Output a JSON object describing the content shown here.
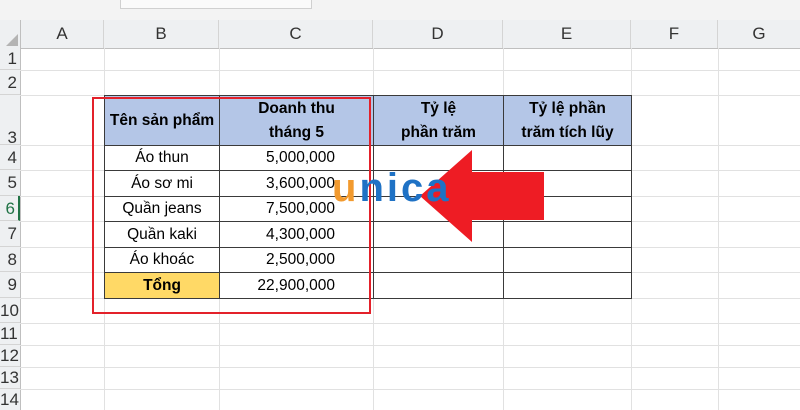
{
  "columns": [
    "A",
    "B",
    "C",
    "D",
    "E",
    "F",
    "G"
  ],
  "rows": [
    "1",
    "2",
    "3",
    "4",
    "5",
    "6",
    "7",
    "8",
    "9",
    "10",
    "11",
    "12",
    "13",
    "14"
  ],
  "table": {
    "header": {
      "product": "Tên sản phẩm",
      "revenue": "Doanh thu\ntháng 5",
      "percent": "Tỷ lệ\nphần trăm",
      "cumulative": "Tỷ lệ phần\ntrăm tích lũy"
    },
    "items": [
      {
        "name": "Áo thun",
        "revenue": "5,000,000"
      },
      {
        "name": "Áo sơ mi",
        "revenue": "3,600,000"
      },
      {
        "name": "Quần jeans",
        "revenue": "7,500,000"
      },
      {
        "name": "Quần kaki",
        "revenue": "4,300,000"
      },
      {
        "name": "Áo khoác",
        "revenue": "2,500,000"
      }
    ],
    "total": {
      "label": "Tổng",
      "revenue": "22,900,000"
    }
  },
  "watermark": {
    "first": "u",
    "rest": "nica"
  },
  "colors": {
    "header_fill": "#b4c6e7",
    "total_fill": "#ffd966",
    "highlight": "#e3212a",
    "arrow": "#ee1c24"
  },
  "icons": {
    "arrow": "red-left-arrow",
    "logo": "unica-logo"
  }
}
